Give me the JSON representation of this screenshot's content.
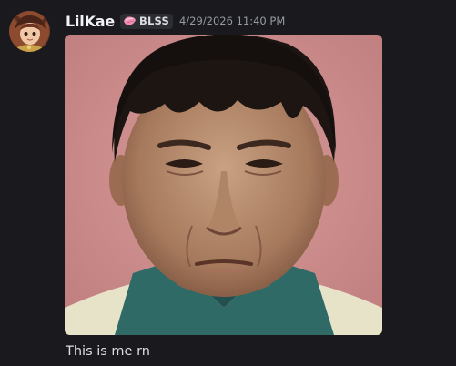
{
  "message": {
    "author": "LilKae",
    "tag": "BLSS",
    "timestamp": "4/29/2026 11:40 PM",
    "content": "This is me rn"
  },
  "icons": {
    "avatar": "anime-character-avatar",
    "tag": "pink-gem-icon",
    "attachment": "portrait-photo"
  },
  "colors": {
    "background": "#1a1a1e",
    "username": "#f2f3f5",
    "timestamp": "#949ba4",
    "tag_background": "#2c2d33",
    "tag_icon": "#f48fb1"
  }
}
